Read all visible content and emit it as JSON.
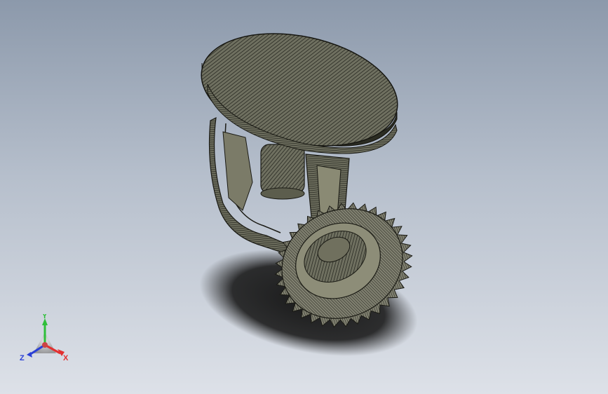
{
  "viewport": {
    "background_top": "#8c99ab",
    "background_bottom": "#dde1e8",
    "model": "sprinkler-head-3d-model"
  },
  "triad": {
    "x_label": "X",
    "y_label": "Y",
    "z_label": "Z",
    "x_color": "#e23030",
    "y_color": "#2fbf3a",
    "z_color": "#2a3fd6"
  }
}
